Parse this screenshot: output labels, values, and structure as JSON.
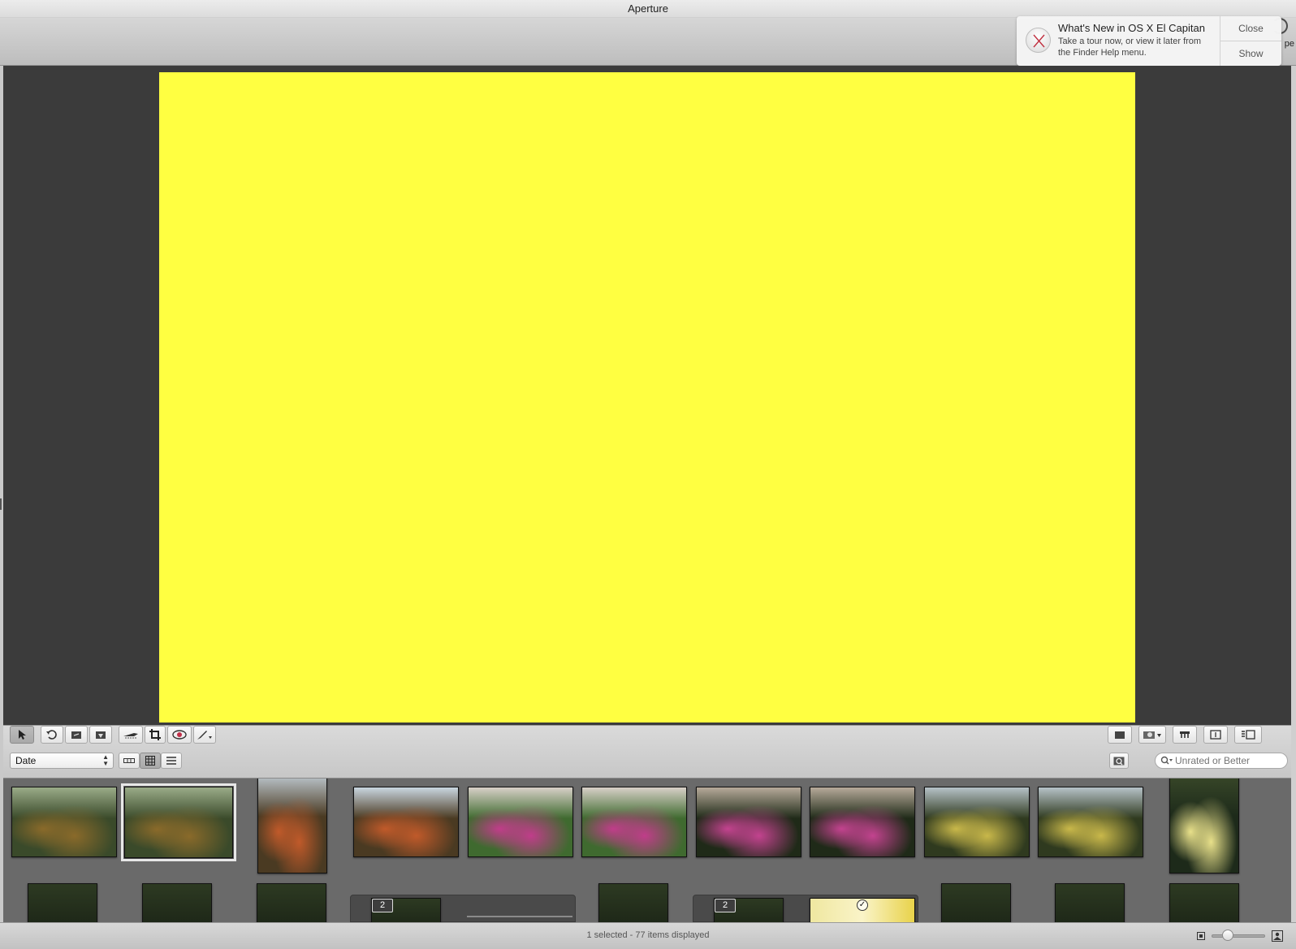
{
  "window": {
    "title": "Aperture"
  },
  "toolbar_top": {
    "truncated_label": "pe"
  },
  "notification": {
    "title": "What's New in OS X El Capitan",
    "body": "Take a tour now, or view it later from the Finder Help menu.",
    "close_label": "Close",
    "show_label": "Show"
  },
  "viewer": {
    "photo_color": "#ffff41"
  },
  "browser": {
    "sort_select": "Date",
    "filter_placeholder": "Unrated or Better",
    "tools_left": [
      "select-tool-icon",
      "rotate-left-icon",
      "straighten-icon",
      "lift-stamp-icon",
      "quick-fix-icon",
      "crop-icon",
      "red-eye-icon",
      "brush-menu-icon"
    ],
    "view_modes": [
      "filmstrip-view-icon",
      "grid-view-icon",
      "list-view-icon"
    ],
    "tools_right": [
      "viewer-mode-icon",
      "loupe-menu-icon",
      "stamp-tool-icon",
      "single-view-icon",
      "multi-view-icon"
    ]
  },
  "thumbnails": [
    {
      "subject": "willow trees",
      "colors": [
        "#3a4a2a",
        "#8a6a2a",
        "#9aab88"
      ],
      "selected": false
    },
    {
      "subject": "willow trees",
      "colors": [
        "#3a4a2a",
        "#8a6a2a",
        "#9aab88"
      ],
      "selected": true
    },
    {
      "subject": "red berry tree",
      "colors": [
        "#4a3a22",
        "#c05a2a",
        "#c9d6e0"
      ],
      "selected": false
    },
    {
      "subject": "red berry tree",
      "colors": [
        "#4a3a22",
        "#c05a2a",
        "#c9d6e0"
      ],
      "selected": false
    },
    {
      "subject": "pink flower bed",
      "colors": [
        "#3f6a2f",
        "#c03d8a",
        "#d8d0c8"
      ],
      "selected": false
    },
    {
      "subject": "pink flower bed",
      "colors": [
        "#3f6a2f",
        "#c03d8a",
        "#d8d0c8"
      ],
      "selected": false
    },
    {
      "subject": "pink flowers closeup",
      "colors": [
        "#1f2a18",
        "#c3438f",
        "#b7aa9a"
      ],
      "selected": false
    },
    {
      "subject": "pink flowers closeup",
      "colors": [
        "#1f2a18",
        "#c3438f",
        "#b7aa9a"
      ],
      "selected": false
    },
    {
      "subject": "yellow flowers bed",
      "colors": [
        "#2f3a1f",
        "#c9b84a",
        "#b6c2c8"
      ],
      "selected": false
    },
    {
      "subject": "yellow flowers bed",
      "colors": [
        "#2f3a1f",
        "#c9b84a",
        "#b6c2c8"
      ],
      "selected": false
    },
    {
      "subject": "yellow flower portrait",
      "colors": [
        "#1d2a1a",
        "#e8e08a",
        "#3b4a2a"
      ],
      "selected": false
    }
  ],
  "stacks": [
    {
      "badge": "2"
    },
    {
      "badge": "2"
    }
  ],
  "status": {
    "text": "1 selected - 77 items displayed",
    "zoom_level": 0.3
  }
}
